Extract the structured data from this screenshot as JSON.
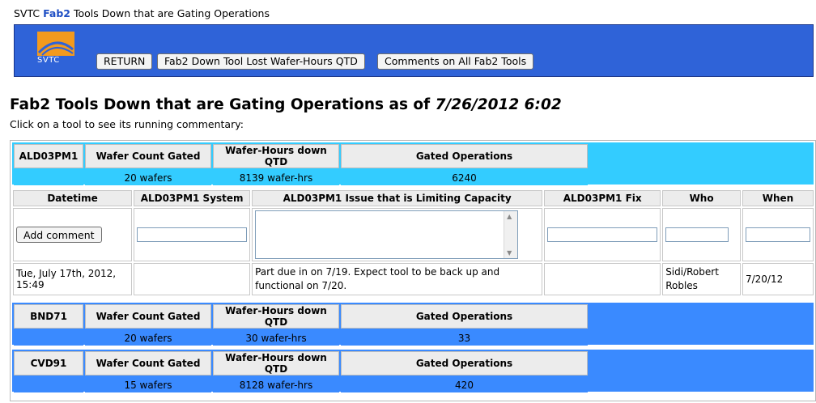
{
  "topline": {
    "prefix": "SVTC",
    "fab": "Fab2",
    "suffix": "Tools Down that are Gating Operations"
  },
  "banner": {
    "logo_text": "SVTC",
    "buttons": [
      "RETURN",
      "Fab2 Down Tool Lost Wafer-Hours QTD",
      "Comments on All Fab2 Tools"
    ]
  },
  "heading": {
    "text": "Fab2 Tools Down that are Gating Operations as of",
    "datetime": "7/26/2012 6:02"
  },
  "subheading": "Click on a tool to see its running commentary:",
  "columns": {
    "wafer_count": "Wafer Count Gated",
    "wafer_hours": "Wafer-Hours down QTD",
    "gated_ops": "Gated Operations"
  },
  "tools": [
    {
      "name": "ALD03PM1",
      "wafer_count": "20 wafers",
      "wafer_hours": "8139 wafer-hrs",
      "gated_ops": "6240",
      "color": "#33ccff"
    },
    {
      "name": "BND71",
      "wafer_count": "20 wafers",
      "wafer_hours": "30 wafer-hrs",
      "gated_ops": "33",
      "color": "#3a8aff"
    },
    {
      "name": "CVD91",
      "wafer_count": "15 wafers",
      "wafer_hours": "8128 wafer-hrs",
      "gated_ops": "420",
      "color": "#3a8aff"
    }
  ],
  "commentary": {
    "headers": [
      "Datetime",
      "ALD03PM1 System",
      "ALD03PM1 Issue that is Limiting Capacity",
      "ALD03PM1 Fix",
      "Who",
      "When"
    ],
    "add_button": "Add comment",
    "rows": [
      {
        "datetime": "Tue, July 17th, 2012, 15:49",
        "system": "",
        "issue": "Part due in on 7/19. Expect tool to be back up and functional on 7/20.",
        "fix": "",
        "who": "Sidi/Robert Robles",
        "when": "7/20/12"
      }
    ]
  }
}
